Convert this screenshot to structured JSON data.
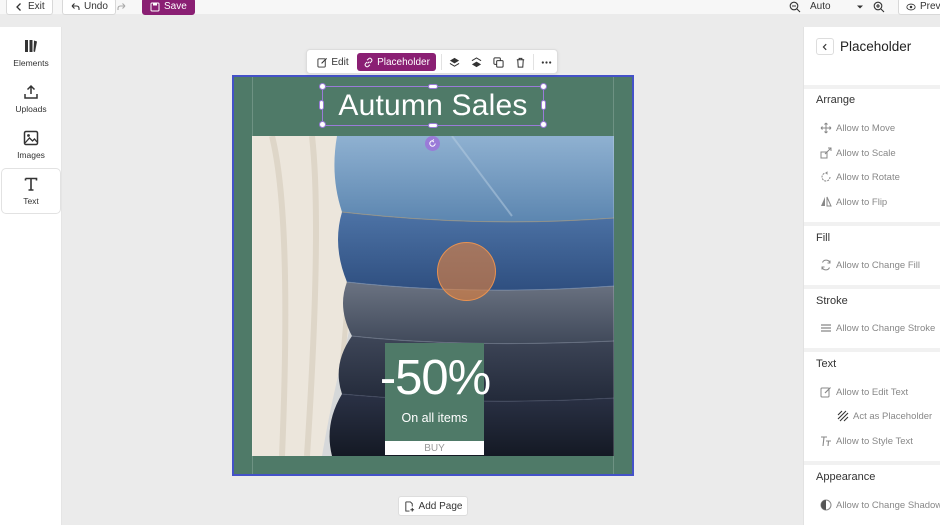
{
  "topbar": {
    "exit_label": "Exit",
    "undo_label": "Undo",
    "save_label": "Save",
    "zoom_value": "Auto",
    "preview_label": "Prev"
  },
  "sidebar": {
    "items": [
      {
        "label": "Elements",
        "icon": "elements-icon"
      },
      {
        "label": "Uploads",
        "icon": "upload-icon"
      },
      {
        "label": "Images",
        "icon": "image-icon"
      },
      {
        "label": "Text",
        "icon": "text-icon"
      }
    ],
    "active": "Text"
  },
  "toolbar": {
    "edit_label": "Edit",
    "placeholder_label": "Placeholder"
  },
  "design": {
    "title": "Autumn Sales",
    "discount": "-50%",
    "subtitle": "On all items",
    "button": "BUY",
    "background_color": "#4f7a68"
  },
  "canvas": {
    "add_page_label": "Add Page"
  },
  "panel": {
    "title": "Placeholder",
    "sections": [
      {
        "title": "Arrange",
        "options": [
          "Allow to Move",
          "Allow to Scale",
          "Allow to Rotate",
          "Allow to Flip"
        ]
      },
      {
        "title": "Fill",
        "options": [
          "Allow to Change Fill"
        ]
      },
      {
        "title": "Stroke",
        "options": [
          "Allow to Change Stroke"
        ]
      },
      {
        "title": "Text",
        "options": [
          "Allow to Edit Text",
          "Act as Placeholder",
          "Allow to Style Text"
        ]
      },
      {
        "title": "Appearance",
        "options": [
          "Allow to Change Shadow"
        ]
      }
    ]
  },
  "colors": {
    "accent": "#8a1f73",
    "selection": "#9a7bd8",
    "page_border": "#4452c8"
  }
}
